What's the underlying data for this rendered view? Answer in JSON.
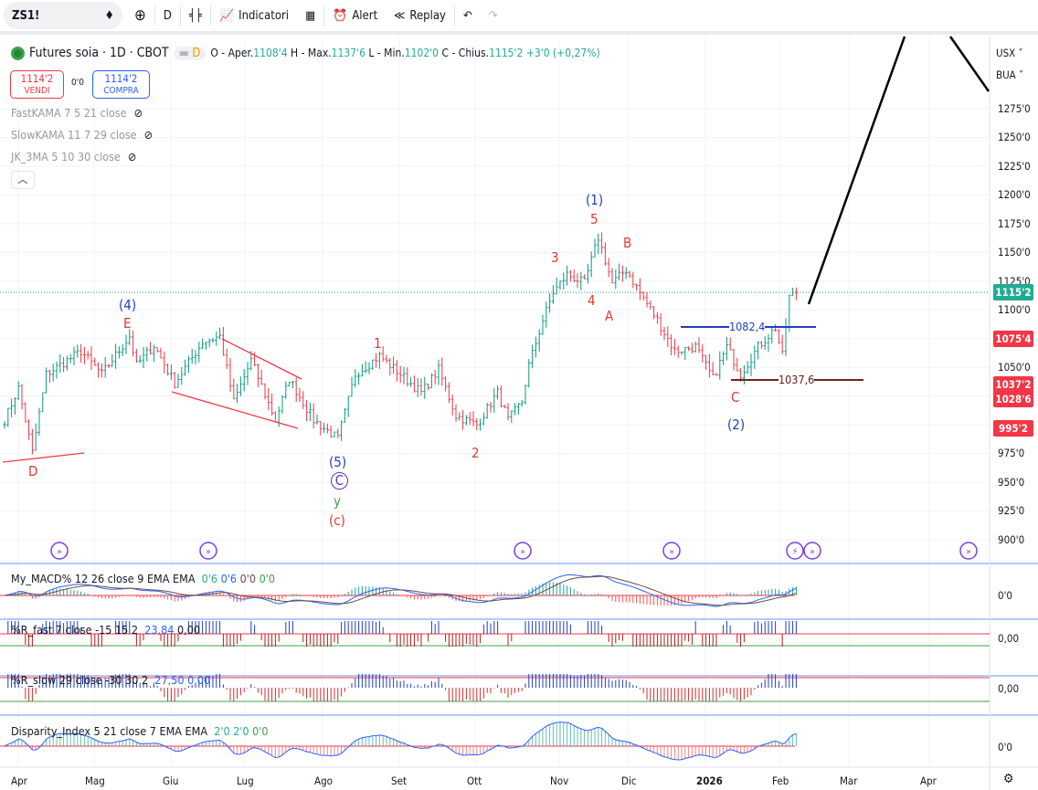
{
  "toolbar": {
    "symbol": "ZS1!",
    "interval": "D",
    "indicators": "Indicatori",
    "alert": "Alert",
    "replay": "Replay"
  },
  "legend": {
    "title": "Futures soia · 1D · CBOT",
    "badge": "D",
    "open_label": "O - Aper.",
    "open": "1108'4",
    "high_label": "H - Max.",
    "high": "1137'6",
    "low_label": "L - Min.",
    "low": "1102'0",
    "close_label": "C - Chius.",
    "close": "1115'2",
    "change": "+3'0 (+0,27%)"
  },
  "trade": {
    "sell_price": "1114'2",
    "sell_label": "VENDI",
    "spread": "0'0",
    "buy_price": "1114'2",
    "buy_label": "COMPRA"
  },
  "hidden_indicators": [
    "FastKAMA 7 5 21 close",
    "SlowKAMA 11 7 29 close",
    "JK_3MA 5 10 30 close"
  ],
  "units": {
    "currency": "USX",
    "unit": "BUA"
  },
  "price_axis": [
    "1275'0",
    "1250'0",
    "1225'0",
    "1200'0",
    "1175'0",
    "1150'0",
    "1125'0",
    "1100'0",
    "1050'0",
    "975'0",
    "950'0",
    "925'0",
    "900'0"
  ],
  "price_labels": [
    {
      "text": "1115'2",
      "color": "#22ab94"
    },
    {
      "text": "1075'4",
      "color": "#f23645"
    },
    {
      "text": "1037'2",
      "color": "#f23645"
    },
    {
      "text": "1028'6",
      "color": "#f23645"
    },
    {
      "text": "995'2",
      "color": "#f23645"
    }
  ],
  "levels": {
    "blue": "1082,4",
    "red": "1037,6"
  },
  "waves": [
    "(4)",
    "E",
    "D",
    "1",
    "2",
    "(5)",
    "C",
    "y",
    "(c)",
    "3",
    "4",
    "5",
    "(1)",
    "A",
    "B",
    "C",
    "(2)"
  ],
  "panes": {
    "macd": {
      "name": "My_MACD% 12 26 close 9 EMA EMA",
      "v": [
        "0'6",
        "0'6",
        "0'0",
        "0'0"
      ],
      "axis": "0'0"
    },
    "rfast": {
      "name": "%R_fast 7 close -15 15 2",
      "v": [
        "23,84",
        "0,00"
      ],
      "axis": "0,00"
    },
    "rslow": {
      "name": "%R_slow 29 close -30 30 2",
      "v": [
        "27,50",
        "0,00"
      ],
      "axis": "0,00"
    },
    "disp": {
      "name": "Disparity_Index 5 21 close 7 EMA EMA",
      "v": [
        "2'0",
        "2'0",
        "0'0"
      ],
      "axis": "0'0"
    }
  },
  "time_axis": [
    "Apr",
    "Mag",
    "Giu",
    "Lug",
    "Ago",
    "Set",
    "Ott",
    "Nov",
    "Dic",
    "2026",
    "Feb",
    "Mar",
    "Apr"
  ],
  "chart_data": {
    "type": "ohlc",
    "ylim": [
      900,
      1275
    ],
    "anchors": [
      [
        0,
        1004
      ],
      [
        4,
        1032
      ],
      [
        8,
        976
      ],
      [
        12,
        1044
      ],
      [
        22,
        1064
      ],
      [
        28,
        1044
      ],
      [
        36,
        1077
      ],
      [
        38,
        1052
      ],
      [
        43,
        1069
      ],
      [
        49,
        1036
      ],
      [
        57,
        1072
      ],
      [
        62,
        1077
      ],
      [
        66,
        1020
      ],
      [
        71,
        1056
      ],
      [
        78,
        1004
      ],
      [
        82,
        1040
      ],
      [
        89,
        1004
      ],
      [
        96,
        988
      ],
      [
        101,
        1044
      ],
      [
        108,
        1060
      ],
      [
        114,
        1044
      ],
      [
        120,
        1028
      ],
      [
        125,
        1048
      ],
      [
        130,
        1008
      ],
      [
        136,
        1000
      ],
      [
        142,
        1028
      ],
      [
        145,
        1004
      ],
      [
        149,
        1020
      ],
      [
        151,
        1052
      ],
      [
        155,
        1091
      ],
      [
        158,
        1115
      ],
      [
        162,
        1131
      ],
      [
        167,
        1123
      ],
      [
        171,
        1163
      ],
      [
        175,
        1123
      ],
      [
        179,
        1135
      ],
      [
        183,
        1115
      ],
      [
        188,
        1091
      ],
      [
        193,
        1064
      ],
      [
        199,
        1068
      ],
      [
        204,
        1040
      ],
      [
        208,
        1068
      ],
      [
        212,
        1044
      ],
      [
        217,
        1068
      ],
      [
        222,
        1084
      ],
      [
        224,
        1060
      ],
      [
        226,
        1111
      ],
      [
        228,
        1115
      ]
    ]
  }
}
